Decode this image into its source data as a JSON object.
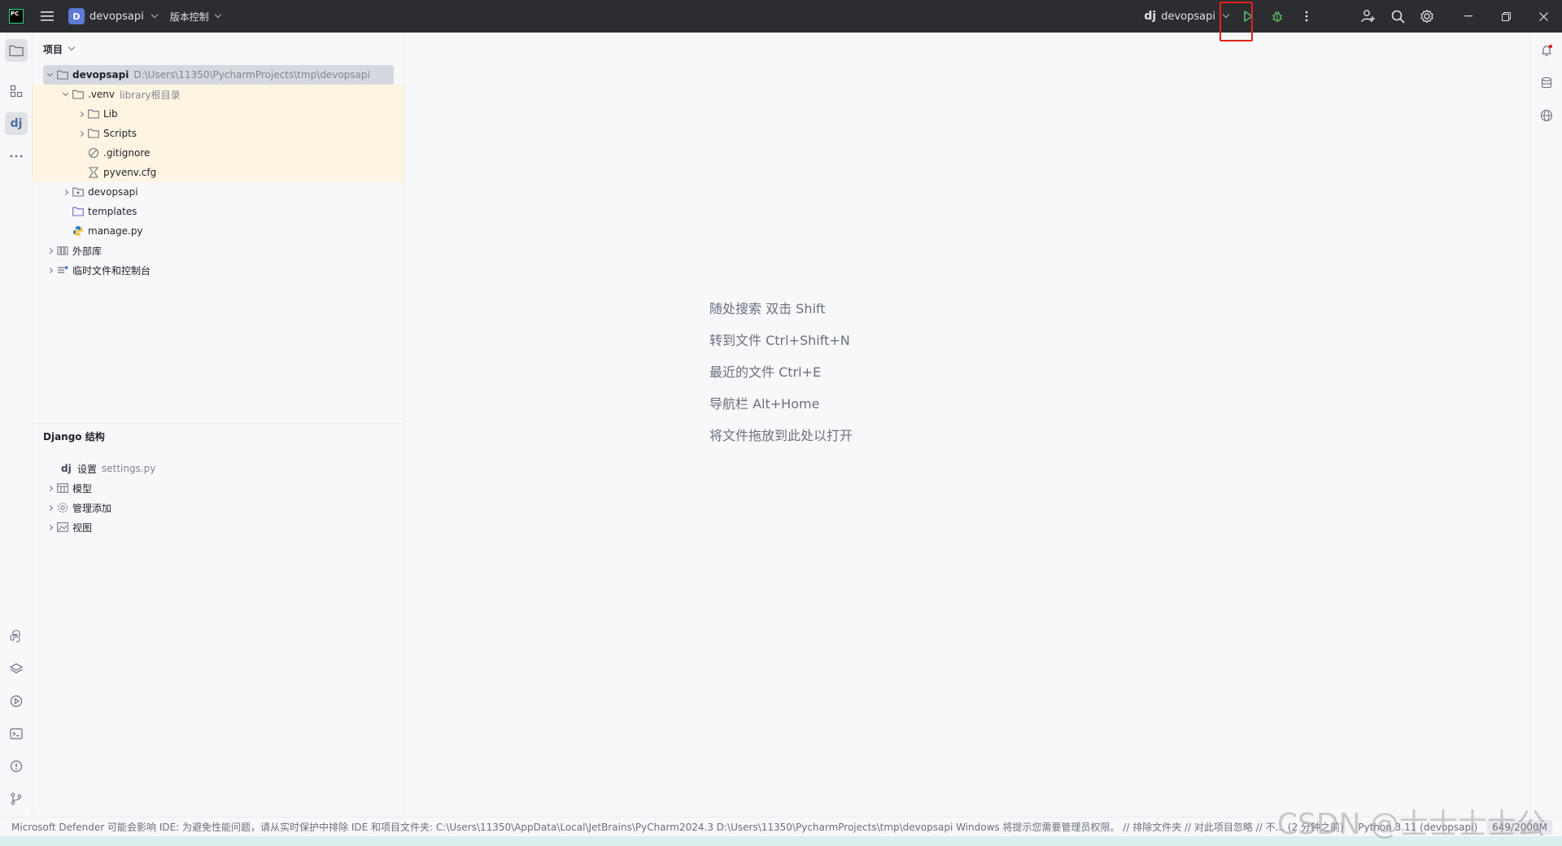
{
  "titlebar": {
    "project_badge": "D",
    "project_name": "devopsapi",
    "vcs_label": "版本控制",
    "run_config_prefix": "dj",
    "run_config_name": "devopsapi"
  },
  "project_panel": {
    "title": "项目",
    "tree": [
      {
        "name": "devopsapi",
        "hint": "D:\\Users\\11350\\PycharmProjects\\tmp\\devopsapi"
      },
      {
        "name": ".venv",
        "hint": "library根目录"
      },
      {
        "name": "Lib"
      },
      {
        "name": "Scripts"
      },
      {
        "name": ".gitignore"
      },
      {
        "name": "pyvenv.cfg"
      },
      {
        "name": "devopsapi"
      },
      {
        "name": "templates"
      },
      {
        "name": "manage.py"
      },
      {
        "name": "外部库"
      },
      {
        "name": "临时文件和控制台"
      }
    ]
  },
  "django_panel": {
    "title": "Django 结构",
    "items": [
      {
        "prefix": "dj",
        "label": "设置",
        "hint": "settings.py"
      },
      {
        "label": "模型"
      },
      {
        "label": "管理添加"
      },
      {
        "label": "视图"
      }
    ]
  },
  "editor": {
    "hints": [
      "随处搜索 双击 Shift",
      "转到文件 Ctrl+Shift+N",
      "最近的文件 Ctrl+E",
      "导航栏 Alt+Home",
      "将文件拖放到此处以打开"
    ]
  },
  "statusbar": {
    "message": "Microsoft Defender 可能会影响 IDE: 为避免性能问题，请从实时保护中排除 IDE 和项目文件夹: C:\\Users\\11350\\AppData\\Local\\JetBrains\\PyCharm2024.3 D:\\Users\\11350\\PycharmProjects\\tmp\\devopsapi Windows 将提示您需要管理员权限。 // 排除文件夹 // 对此项目忽略 // 不... (2 分钟之前)",
    "interpreter": "Python 3.11 (devopsapi)",
    "memory": "649/2000M"
  },
  "watermark": "CSDN @士士士士公",
  "colors": {
    "titlebar_bg": "#2b2d30",
    "run_green": "#5fb865",
    "highlight_red": "#e0241a",
    "selection": "#d5d8de",
    "venv_highlight": "#fdf5e2"
  }
}
